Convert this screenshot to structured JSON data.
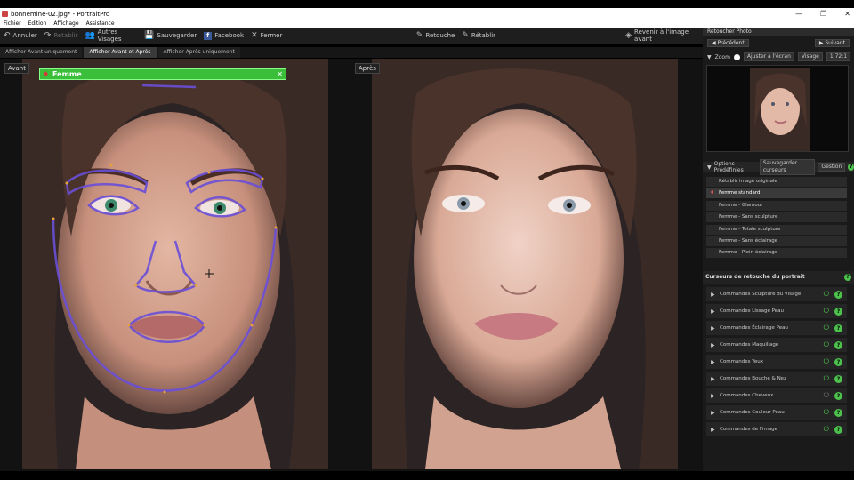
{
  "window": {
    "title": "bonnemine-02.jpg* - PortraitPro",
    "controls": [
      "—",
      "❐",
      "✕"
    ]
  },
  "menu": [
    "Fichier",
    "Édition",
    "Affichage",
    "Assistance"
  ],
  "toolbar": {
    "undo": "Annuler",
    "redo": "Rétablir",
    "other_faces": "Autres Visages",
    "save": "Sauvegarder",
    "facebook": "Facebook",
    "close": "Fermer",
    "retouch": "Retouche",
    "restore": "Rétablir",
    "back_to_before": "Revenir à l'image avant"
  },
  "view_tabs": [
    "Afficher Avant uniquement",
    "Afficher Avant et Après",
    "Afficher Après uniquement"
  ],
  "active_view_tab": 1,
  "panes": {
    "before_label": "Avant",
    "after_label": "Après",
    "face_type": "Femme"
  },
  "side": {
    "header": "Retoucher Photo",
    "prev": "◀ Précédent",
    "next": "▶ Suivant",
    "zoom_label": "Zoom",
    "fit_screen": "Ajuster à l'écran",
    "face_btn": "Visage",
    "zoom_value": "1.72:1",
    "presets_label": "Options Prédéfinies",
    "save_sliders": "Sauvegarder curseurs",
    "manage": "Gestion",
    "presets": [
      "Rétablir image originale",
      "Femme standard",
      "Femme - Glamour",
      "Femme - Sans sculpture",
      "Femme - Totale sculpture",
      "Femme - Sans éclairage",
      "Femme - Plein éclairage"
    ],
    "selected_preset": 1,
    "sliders_header": "Curseurs de retouche du portrait",
    "sliders": [
      {
        "label": "Commandes Sculpture du Visage",
        "on": true
      },
      {
        "label": "Commandes Lissage Peau",
        "on": true
      },
      {
        "label": "Commandes Éclairage Peau",
        "on": true
      },
      {
        "label": "Commandes Maquillage",
        "on": true
      },
      {
        "label": "Commandes Yeux",
        "on": true
      },
      {
        "label": "Commandes Bouche & Nez",
        "on": true
      },
      {
        "label": "Commandes Cheveux",
        "on": false
      },
      {
        "label": "Commandes Couleur Peau",
        "on": true
      },
      {
        "label": "Commandes de l'image",
        "on": true
      }
    ]
  },
  "colors": {
    "accent_green": "#3bbf3b",
    "outline_purple": "#6a4fd8",
    "facebook_blue": "#3b5998"
  }
}
